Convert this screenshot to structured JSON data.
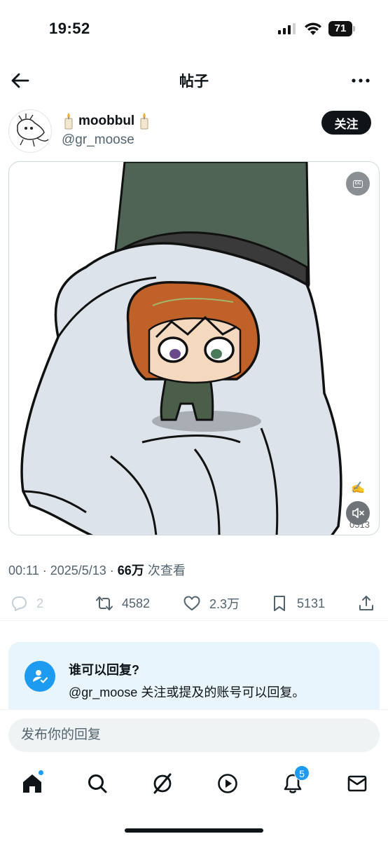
{
  "status_bar": {
    "time": "19:52",
    "battery": "71"
  },
  "nav": {
    "title": "帖子"
  },
  "author": {
    "display_name": "moobbul",
    "handle": "@gr_moose",
    "follow_label": "关注"
  },
  "media": {
    "cc_label": "CC",
    "artist_signature": "0513"
  },
  "meta": {
    "time": "00:11",
    "date": "2025/5/13",
    "separator": " · ",
    "views_count": "66万",
    "views_label": " 次查看"
  },
  "actions": {
    "replies": "2",
    "reposts": "4582",
    "likes": "2.3万",
    "bookmarks": "5131"
  },
  "reply_restriction": {
    "title": "谁可以回复?",
    "description": "@gr_moose 关注或提及的账号可以回复。"
  },
  "composer": {
    "placeholder": "发布你的回复"
  },
  "tab_bar": {
    "notifications_badge": "5"
  },
  "colors": {
    "accent": "#1d9bf0",
    "text": "#0f1419",
    "muted": "#536471",
    "card_bg": "#e8f5fd"
  },
  "icons": [
    "back-arrow-icon",
    "more-icon",
    "candle-icon",
    "cc-icon",
    "mute-icon",
    "reply-icon",
    "repost-icon",
    "like-icon",
    "bookmark-icon",
    "share-icon",
    "person-check-icon",
    "home-icon",
    "search-icon",
    "grok-icon",
    "video-icon",
    "bell-icon",
    "mail-icon"
  ]
}
